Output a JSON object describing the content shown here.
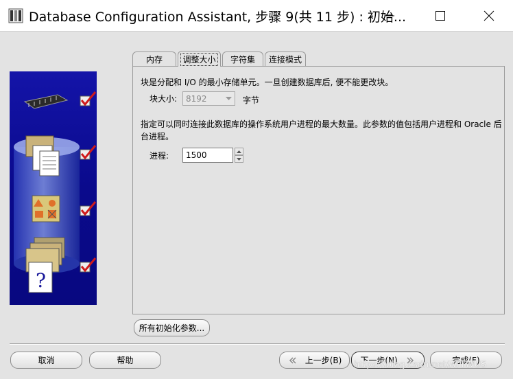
{
  "window": {
    "title": "Database Configuration Assistant, 步骤 9(共 11 步) : 初始...",
    "minimize": "minimize",
    "maximize": "maximize",
    "close": "close"
  },
  "tabs": [
    {
      "label": "内存",
      "active": false
    },
    {
      "label": "调整大小",
      "active": true
    },
    {
      "label": "字符集",
      "active": false
    },
    {
      "label": "连接模式",
      "active": false
    }
  ],
  "sizing": {
    "block_desc": "块是分配和 I/O 的最小存储单元。一旦创建数据库后, 便不能更改块。",
    "block_size_label": "块大小:",
    "block_size_value": "8192",
    "block_size_unit": "字节",
    "process_desc_line1": "指定可以同时连接此数据库的操作系统用户进程的最大数量。此参数的值包括用户进程和 Oracle 后",
    "process_desc_line2": "台进程。",
    "process_label": "进程:",
    "process_value": "1500"
  },
  "buttons": {
    "all_params": "所有初始化参数...",
    "cancel": "取消",
    "help": "帮助",
    "back": "上一步(B)",
    "next": "下一步(N)",
    "finish": "完成(F)"
  },
  "watermark": "https://blog.csdn.net/ATTWUS",
  "colors": {
    "panel_blue": "#0a0a8c",
    "check_red": "#d01a1a"
  }
}
